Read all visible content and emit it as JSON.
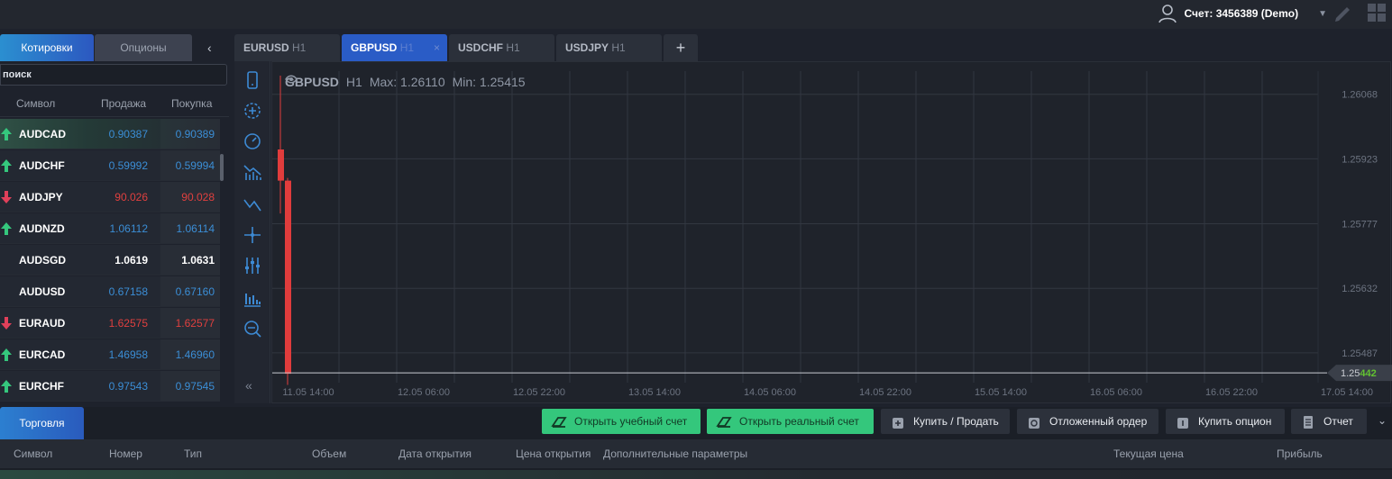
{
  "account": {
    "label": "Счет: 3456389 (Demo)",
    "icons": [
      "user-icon",
      "caret-down-icon",
      "brush-icon",
      "grid-icon"
    ]
  },
  "left_tabs": {
    "quotes": "Котировки",
    "options": "Опционы"
  },
  "search": {
    "placeholder": "поиск"
  },
  "quotes": {
    "headers": {
      "symbol": "Символ",
      "bid": "Продажа",
      "ask": "Покупка"
    },
    "rows": [
      {
        "symbol": "AUDCAD",
        "bid": "0.90387",
        "ask": "0.90389",
        "trend": "up",
        "color": "blue"
      },
      {
        "symbol": "AUDCHF",
        "bid": "0.59992",
        "ask": "0.59994",
        "trend": "up",
        "color": "blue"
      },
      {
        "symbol": "AUDJPY",
        "bid": "90.026",
        "ask": "90.028",
        "trend": "down",
        "color": "red"
      },
      {
        "symbol": "AUDNZD",
        "bid": "1.06112",
        "ask": "1.06114",
        "trend": "up",
        "color": "blue"
      },
      {
        "symbol": "AUDSGD",
        "bid": "1.0619",
        "ask": "1.0631",
        "trend": "none",
        "color": "white"
      },
      {
        "symbol": "AUDUSD",
        "bid": "0.67158",
        "ask": "0.67160",
        "trend": "none",
        "color": "blue"
      },
      {
        "symbol": "EURAUD",
        "bid": "1.62575",
        "ask": "1.62577",
        "trend": "down",
        "color": "red"
      },
      {
        "symbol": "EURCAD",
        "bid": "1.46958",
        "ask": "1.46960",
        "trend": "up",
        "color": "blue"
      },
      {
        "symbol": "EURCHF",
        "bid": "0.97543",
        "ask": "0.97545",
        "trend": "up",
        "color": "blue"
      }
    ]
  },
  "chart_tabs": [
    {
      "symbol": "EURUSD",
      "tf": "H1",
      "active": false
    },
    {
      "symbol": "GBPUSD",
      "tf": "H1",
      "active": true,
      "close": "×"
    },
    {
      "symbol": "USDCHF",
      "tf": "H1",
      "active": false
    },
    {
      "symbol": "USDJPY",
      "tf": "H1",
      "active": false
    }
  ],
  "add_tab": "+",
  "toolbar": {
    "tools": [
      "phone-icon",
      "crosshair-plus-icon",
      "clock-icon",
      "bar-chart-indicator-icon",
      "trend-line-icon",
      "crosshair-icon",
      "sliders-icon",
      "volume-bars-icon",
      "zoom-out-icon"
    ],
    "collapse": "«"
  },
  "chart_header": {
    "symbol": "GBPUSD",
    "tf": "H1",
    "max": "Max: 1.26110",
    "min": "Min: 1.25415"
  },
  "chart_data": {
    "type": "candlestick",
    "x_ticks": [
      "11.05 14:00",
      "12.05 06:00",
      "12.05 22:00",
      "13.05 14:00",
      "14.05 06:00",
      "14.05 22:00",
      "15.05 14:00",
      "16.05 06:00",
      "16.05 22:00",
      "17.05 14:00"
    ],
    "y_ticks": [
      "1.26068",
      "1.25923",
      "1.25777",
      "1.25632",
      "1.25487"
    ],
    "ylim": [
      1.2542,
      1.2612
    ],
    "current_price": {
      "main": "1.25",
      "highlight": "442",
      "value": 1.25442
    },
    "candles": [
      {
        "x": "11.05 14:00",
        "open": 1.25944,
        "high": 1.2611,
        "low": 1.258,
        "close": 1.25874,
        "color": "#e03c3c"
      },
      {
        "x": "11.05 15:00",
        "open": 1.25874,
        "high": 1.2588,
        "low": 1.25415,
        "close": 1.2544,
        "color": "#e03c3c"
      }
    ],
    "grid": true
  },
  "bottom": {
    "tab": "Торговля",
    "buttons": [
      {
        "label": "Открыть учебный счет",
        "style": "green",
        "icon": "open-account-icon"
      },
      {
        "label": "Открыть реальный счет",
        "style": "green",
        "icon": "open-account-icon"
      },
      {
        "label": "Купить / Продать",
        "style": "dark",
        "icon": "plus-bag-icon"
      },
      {
        "label": "Отложенный ордер",
        "style": "dark",
        "icon": "clock-bag-icon"
      },
      {
        "label": "Купить опцион",
        "style": "dark",
        "icon": "dollar-bag-icon"
      },
      {
        "label": "Отчет",
        "style": "dark",
        "icon": "clipboard-icon"
      }
    ],
    "collapse": "⌄",
    "columns": [
      "Символ",
      "Номер",
      "Тип",
      "Объем",
      "Дата открытия",
      "Цена открытия",
      "Дополнительные параметры",
      "Текущая цена",
      "Прибыль"
    ]
  },
  "colors": {
    "accent": "#2a5cc6",
    "green": "#34c77c",
    "up": "#35c77d",
    "down": "#e0405a",
    "candle": "#e03c3c"
  }
}
